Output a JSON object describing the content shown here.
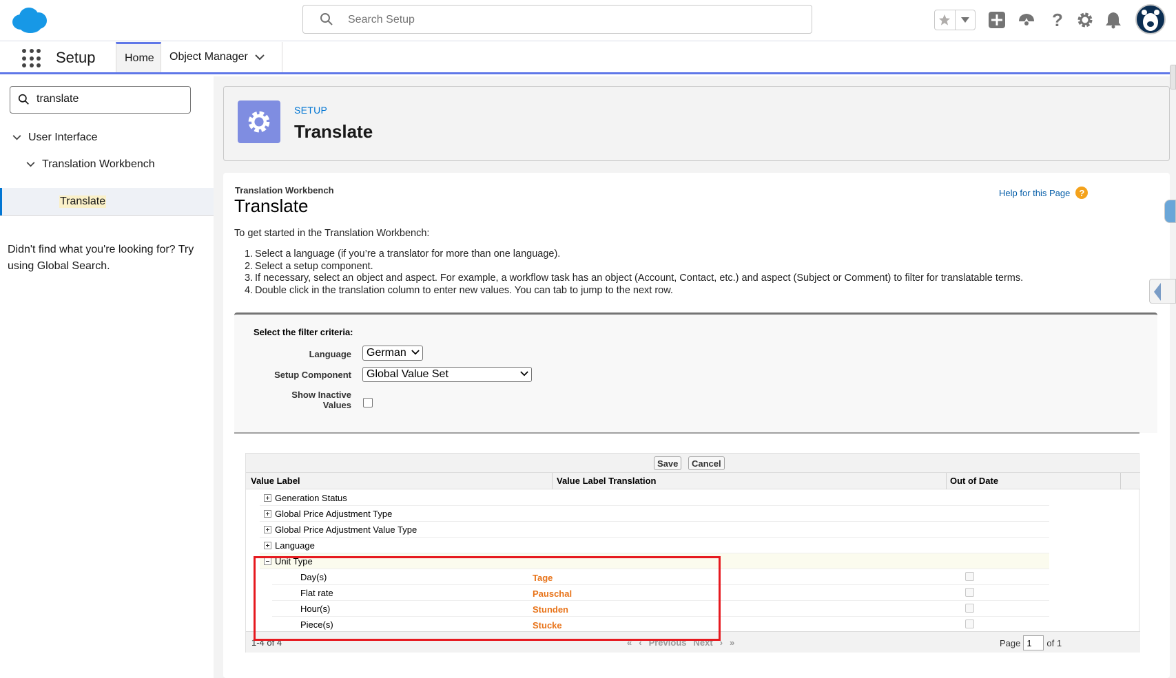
{
  "header": {
    "search_placeholder": "Search Setup",
    "icons": [
      "cloud-logo-icon",
      "search-icon",
      "star-icon",
      "chevron-down-icon",
      "add-icon",
      "trailhead-icon",
      "help-icon",
      "gear-icon",
      "bell-icon",
      "avatar-icon"
    ]
  },
  "nav": {
    "app_name": "Setup",
    "tabs": [
      {
        "label": "Home",
        "active": true
      },
      {
        "label": "Object Manager",
        "has_menu": true
      }
    ]
  },
  "sidebar": {
    "quick_find_value": "translate",
    "tree": [
      {
        "label": "User Interface",
        "expanded": true
      },
      {
        "label": "Translation Workbench",
        "expanded": true
      },
      {
        "label": "Translate",
        "selected": true
      }
    ],
    "not_found_text": "Didn't find what you're looking for? Try using Global Search."
  },
  "page_header": {
    "kicker": "SETUP",
    "title": "Translate"
  },
  "content": {
    "breadcrumb": "Translation Workbench",
    "title": "Translate",
    "help_link": "Help for this Page",
    "intro": "To get started in the Translation Workbench:",
    "steps": [
      "Select a language (if you’re a translator for more than one language).",
      "Select a setup component.",
      "If necessary, select an object and aspect. For example, a workflow task has an object (Account, Contact, etc.) and aspect (Subject or Comment) to filter for translatable terms.",
      "Double click in the translation column to enter new values. You can tab to jump to the next row."
    ]
  },
  "filter": {
    "title": "Select the filter criteria:",
    "language_label": "Language",
    "language_value": "German",
    "component_label": "Setup Component",
    "component_value": "Global Value Set",
    "inactive_label_1": "Show Inactive",
    "inactive_label_2": "Values",
    "show_inactive": false
  },
  "grid": {
    "save_label": "Save",
    "cancel_label": "Cancel",
    "columns": [
      "Value Label",
      "Value Label Translation",
      "Out of Date"
    ],
    "groups": [
      {
        "label": "Generation Status",
        "expanded": false
      },
      {
        "label": "Global Price Adjustment Type",
        "expanded": false
      },
      {
        "label": "Global Price Adjustment Value Type",
        "expanded": false
      },
      {
        "label": "Language",
        "expanded": false
      },
      {
        "label": "Unit Type",
        "expanded": true
      }
    ],
    "rows": [
      {
        "label": "Day(s)",
        "translation": "Tage",
        "out_of_date": false
      },
      {
        "label": "Flat rate",
        "translation": "Pauschal",
        "out_of_date": false
      },
      {
        "label": "Hour(s)",
        "translation": "Stunden",
        "out_of_date": false
      },
      {
        "label": "Piece(s)",
        "translation": "Stucke",
        "out_of_date": false
      }
    ],
    "footer": {
      "count": "1-4 of 4",
      "previous": "Previous",
      "next": "Next",
      "page_label": "Page",
      "page_value": "1",
      "of_label": "of 1"
    }
  },
  "colors": {
    "brand_blue": "#0176d3",
    "setup_gear_bg": "#7f8de1",
    "translation_text": "#e8741a",
    "highlight_box": "#e6191f"
  }
}
